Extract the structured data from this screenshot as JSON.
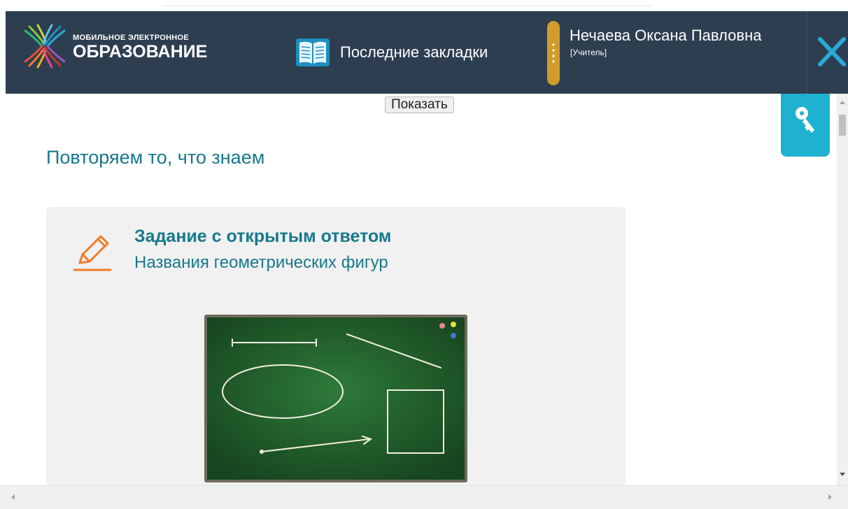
{
  "header": {
    "logo_small": "МОБИЛЬНОЕ ЭЛЕКТРОННОЕ",
    "logo_big": "ОБРАЗОВАНИЕ",
    "bookmarks_label": "Последние закладки",
    "user_name": "Нечаева Оксана Павловна",
    "user_role": "[Учитель]",
    "close_icon": "close-x-icon",
    "bookmarks_icon": "open-book-icon"
  },
  "content": {
    "show_button": "Показать",
    "section_title": "Повторяем то, что знаем",
    "task": {
      "title": "Задание с открытым ответом",
      "subtitle": "Названия геометрических фигур",
      "icon": "pencil-icon",
      "image": "chalkboard-figures-illustration"
    }
  },
  "side": {
    "key_icon": "key-icon"
  },
  "colors": {
    "header_bg": "#2d3e50",
    "accent_teal": "#17788d",
    "key_button": "#1eb2d0",
    "pencil_orange": "#f07a2a",
    "user_pill": "#d39b2c",
    "close_x": "#2aa9d8"
  }
}
